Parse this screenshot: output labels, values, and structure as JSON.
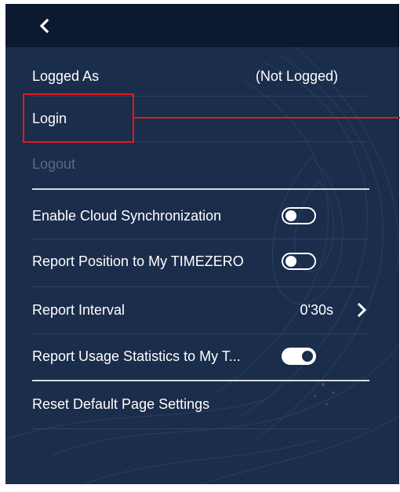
{
  "header": {
    "back_icon": "chevron-left-icon"
  },
  "account": {
    "logged_as_label": "Logged As",
    "logged_as_value": "(Not Logged)",
    "login_label": "Login",
    "logout_label": "Logout"
  },
  "settings": {
    "cloud_sync_label": "Enable Cloud Synchronization",
    "cloud_sync_on": false,
    "report_position_label": "Report Position to My TIMEZERO",
    "report_position_on": false,
    "report_interval_label": "Report Interval",
    "report_interval_value": "0'30s",
    "usage_stats_label": "Report Usage Statistics to My T...",
    "usage_stats_on": true,
    "reset_label": "Reset Default Page Settings"
  },
  "colors": {
    "panel_bg": "#1a2d4b",
    "header_bg": "#0c1a30",
    "highlight": "#e81818",
    "disabled_text": "#5a6a82"
  }
}
